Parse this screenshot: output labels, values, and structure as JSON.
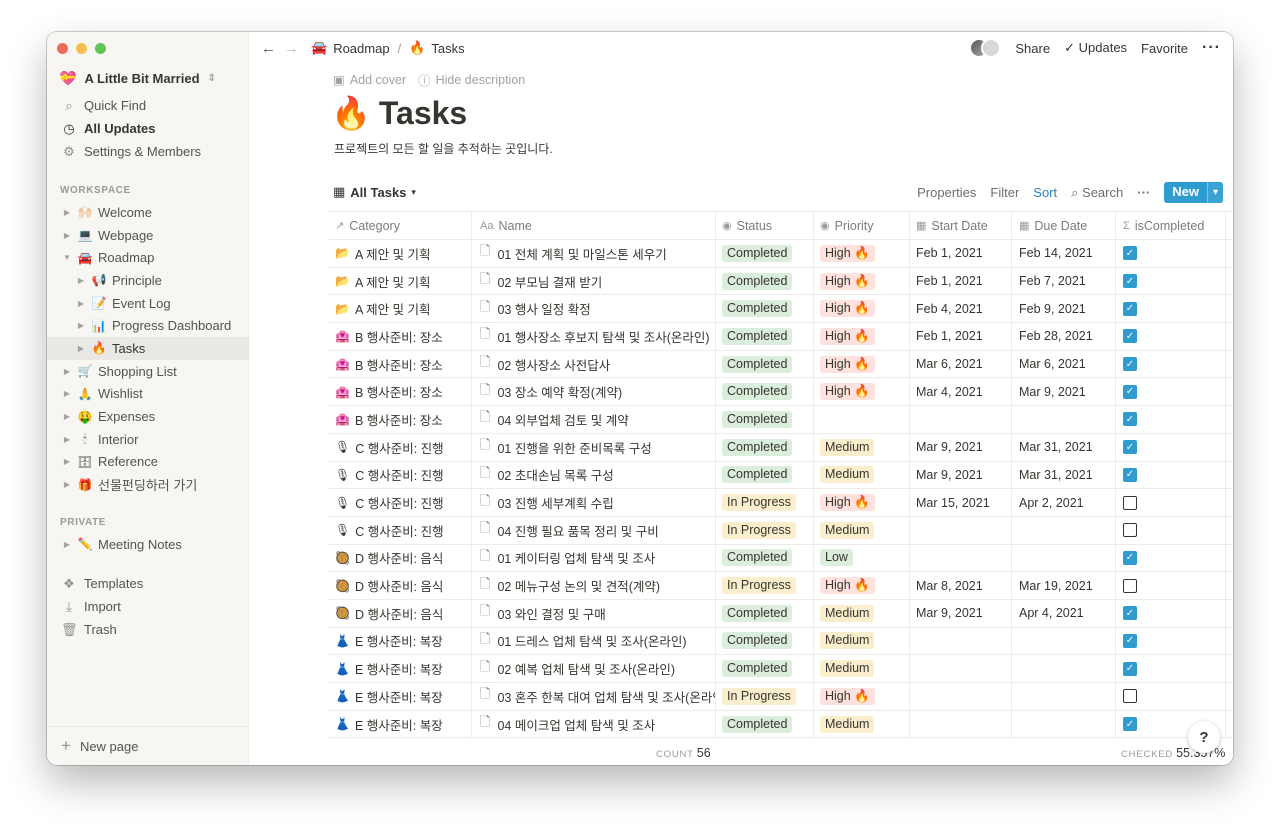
{
  "sidebar": {
    "workspace": {
      "emoji": "💝",
      "name": "A Little Bit Married"
    },
    "top_items": [
      {
        "icon": "🔍",
        "label": "Quick Find"
      },
      {
        "icon": "◷",
        "label": "All Updates"
      },
      {
        "icon": "⚙",
        "label": "Settings & Members"
      }
    ],
    "workspace_label": "WORKSPACE",
    "tree": [
      {
        "emoji": "🙌🏻",
        "label": "Welcome",
        "level": 0
      },
      {
        "emoji": "💻",
        "label": "Webpage",
        "level": 0
      },
      {
        "emoji": "🚘",
        "label": "Roadmap",
        "level": 0,
        "open": true
      },
      {
        "emoji": "📢",
        "label": "Principle",
        "level": 1
      },
      {
        "emoji": "📝",
        "label": "Event Log",
        "level": 1
      },
      {
        "emoji": "📊",
        "label": "Progress Dashboard",
        "level": 1
      },
      {
        "emoji": "🔥",
        "label": "Tasks",
        "level": 1,
        "selected": true
      },
      {
        "emoji": "🛒",
        "label": "Shopping List",
        "level": 0
      },
      {
        "emoji": "🙏",
        "label": "Wishlist",
        "level": 0
      },
      {
        "emoji": "🤑",
        "label": "Expenses",
        "level": 0
      },
      {
        "emoji": "🕯",
        "label": "Interior",
        "level": 0
      },
      {
        "emoji": "🗄",
        "label": "Reference",
        "level": 0
      },
      {
        "emoji": "🎁",
        "label": "선물펀딩하러 가기",
        "level": 0
      }
    ],
    "private_label": "PRIVATE",
    "private_tree": [
      {
        "emoji": "✏️",
        "label": "Meeting Notes",
        "level": 0
      }
    ],
    "bottom_items": [
      {
        "icon": "🧩",
        "label": "Templates"
      },
      {
        "icon": "⤓",
        "label": "Import"
      },
      {
        "icon": "🗑",
        "label": "Trash"
      }
    ],
    "new_page": "New page"
  },
  "topbar": {
    "crumb1_emoji": "🚘",
    "crumb1": "Roadmap",
    "crumb2_emoji": "🔥",
    "crumb2": "Tasks",
    "share": "Share",
    "updates": "Updates",
    "favorite": "Favorite"
  },
  "page": {
    "add_cover": "Add cover",
    "hide_description": "Hide description",
    "emoji": "🔥",
    "title": "Tasks",
    "description": "프로젝트의 모든 할 일을 추적하는 곳입니다."
  },
  "view": {
    "name": "All Tasks",
    "properties": "Properties",
    "filter": "Filter",
    "sort": "Sort",
    "search": "Search",
    "new": "New"
  },
  "columns": [
    "Category",
    "Name",
    "Status",
    "Priority",
    "Start Date",
    "Due Date",
    "isCompleted"
  ],
  "rows": [
    {
      "cat_emoji": "📂",
      "category": "A 제안 및 기획",
      "name": "01 전체 계획 및 마일스톤 세우기",
      "status": "Completed",
      "priority": "High 🔥",
      "start": "Feb 1, 2021",
      "due": "Feb 14, 2021",
      "done": true
    },
    {
      "cat_emoji": "📂",
      "category": "A 제안 및 기획",
      "name": "02 부모님 결재 받기",
      "status": "Completed",
      "priority": "High 🔥",
      "start": "Feb 1, 2021",
      "due": "Feb 7, 2021",
      "done": true
    },
    {
      "cat_emoji": "📂",
      "category": "A 제안 및 기획",
      "name": "03 행사 일정 확정",
      "status": "Completed",
      "priority": "High 🔥",
      "start": "Feb 4, 2021",
      "due": "Feb 9, 2021",
      "done": true
    },
    {
      "cat_emoji": "🏩",
      "category": "B 행사준비: 장소",
      "name": "01 행사장소 후보지 탐색 및 조사(온라인)",
      "status": "Completed",
      "priority": "High 🔥",
      "start": "Feb 1, 2021",
      "due": "Feb 28, 2021",
      "done": true
    },
    {
      "cat_emoji": "🏩",
      "category": "B 행사준비: 장소",
      "name": "02 행사장소 사전답사",
      "status": "Completed",
      "priority": "High 🔥",
      "start": "Mar 6, 2021",
      "due": "Mar 6, 2021",
      "done": true
    },
    {
      "cat_emoji": "🏩",
      "category": "B 행사준비: 장소",
      "name": "03 장소 예약 확정(계약)",
      "status": "Completed",
      "priority": "High 🔥",
      "start": "Mar 4, 2021",
      "due": "Mar 9, 2021",
      "done": true
    },
    {
      "cat_emoji": "🏩",
      "category": "B 행사준비: 장소",
      "name": "04 외부업체 검토 및 계약",
      "status": "Completed",
      "priority": "",
      "start": "",
      "due": "",
      "done": true
    },
    {
      "cat_emoji": "🎙",
      "category": "C 행사준비: 진행",
      "name": "01 진행을 위한 준비목록 구성",
      "status": "Completed",
      "priority": "Medium",
      "start": "Mar 9, 2021",
      "due": "Mar 31, 2021",
      "done": true
    },
    {
      "cat_emoji": "🎙",
      "category": "C 행사준비: 진행",
      "name": "02 초대손님 목록 구성",
      "status": "Completed",
      "priority": "Medium",
      "start": "Mar 9, 2021",
      "due": "Mar 31, 2021",
      "done": true
    },
    {
      "cat_emoji": "🎙",
      "category": "C 행사준비: 진행",
      "name": "03 진행 세부계획 수립",
      "status": "In Progress",
      "priority": "High 🔥",
      "start": "Mar 15, 2021",
      "due": "Apr 2, 2021",
      "done": false
    },
    {
      "cat_emoji": "🎙",
      "category": "C 행사준비: 진행",
      "name": "04 진행 필요 품목 정리 및 구비",
      "status": "In Progress",
      "priority": "Medium",
      "start": "",
      "due": "",
      "done": false
    },
    {
      "cat_emoji": "🥘",
      "category": "D 행사준비: 음식",
      "name": "01 케이터링 업체 탐색 및 조사",
      "status": "Completed",
      "priority": "Low",
      "start": "",
      "due": "",
      "done": true
    },
    {
      "cat_emoji": "🥘",
      "category": "D 행사준비: 음식",
      "name": "02 메뉴구성 논의 및 견적(계약)",
      "status": "In Progress",
      "priority": "High 🔥",
      "start": "Mar 8, 2021",
      "due": "Mar 19, 2021",
      "done": false
    },
    {
      "cat_emoji": "🥘",
      "category": "D 행사준비: 음식",
      "name": "03 와인 결정 및 구매",
      "status": "Completed",
      "priority": "Medium",
      "start": "Mar 9, 2021",
      "due": "Apr 4, 2021",
      "done": true
    },
    {
      "cat_emoji": "👗",
      "category": "E 행사준비: 복장",
      "name": "01 드레스 업체 탐색 및 조사(온라인)",
      "status": "Completed",
      "priority": "Medium",
      "start": "",
      "due": "",
      "done": true
    },
    {
      "cat_emoji": "👗",
      "category": "E 행사준비: 복장",
      "name": "02 예복 업체 탐색 및 조사(온라인)",
      "status": "Completed",
      "priority": "Medium",
      "start": "",
      "due": "",
      "done": true
    },
    {
      "cat_emoji": "👗",
      "category": "E 행사준비: 복장",
      "name": "03 혼주 한복 대여 업체 탐색 및 조사(온라인",
      "status": "In Progress",
      "priority": "High 🔥",
      "start": "",
      "due": "",
      "done": false
    },
    {
      "cat_emoji": "👗",
      "category": "E 행사준비: 복장",
      "name": "04 메이크업 업체 탐색 및 조사",
      "status": "Completed",
      "priority": "Medium",
      "start": "",
      "due": "",
      "done": true
    }
  ],
  "footer": {
    "count_label": "COUNT",
    "count": "56",
    "checked_label": "CHECKED",
    "checked": "55.357%"
  },
  "help": "?",
  "colors": {
    "accent": "#2f9ccf",
    "completed_bg": "#dbeddb",
    "in_progress_bg": "#fbeecc",
    "high_bg": "#ffe2dd",
    "medium_bg": "#fbeecc",
    "low_bg": "#dbeddb"
  }
}
